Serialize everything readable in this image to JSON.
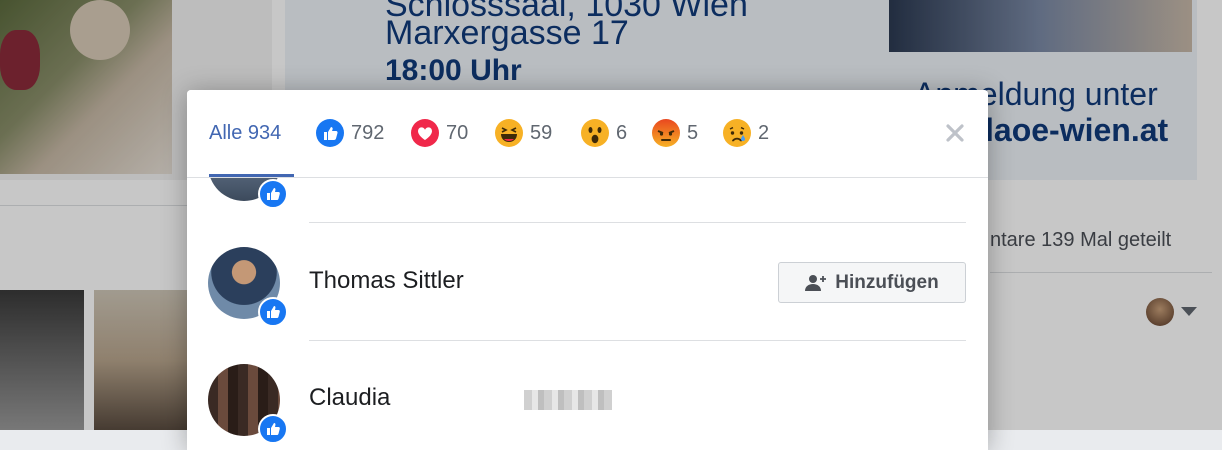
{
  "background": {
    "ad": {
      "line1": "Schlosssaal, 1030 Wien",
      "line2": "Marxergasse 17",
      "line3": "18:00 Uhr",
      "right1": "Anmeldung unter",
      "right2": "laoe-wien.at"
    },
    "share_stats": "ntare  139 Mal geteilt"
  },
  "dialog": {
    "tabs": [
      {
        "label": "Alle 934",
        "icon": "none"
      },
      {
        "label": "792",
        "icon": "like-icon"
      },
      {
        "label": "70",
        "icon": "love-icon"
      },
      {
        "label": "59",
        "icon": "haha-icon"
      },
      {
        "label": "6",
        "icon": "wow-icon"
      },
      {
        "label": "5",
        "icon": "angry-icon"
      },
      {
        "label": "2",
        "icon": "sad-icon"
      }
    ],
    "people": [
      {
        "name": "Thomas Sittler",
        "reaction": "like",
        "button": "Hinzufügen"
      },
      {
        "name": "Claudia",
        "reaction": "like",
        "surname_blurred": true
      }
    ]
  },
  "colors": {
    "accent": "#4267b2",
    "like_blue": "#1877f2",
    "text": "#1c1e21",
    "muted": "#606770"
  }
}
